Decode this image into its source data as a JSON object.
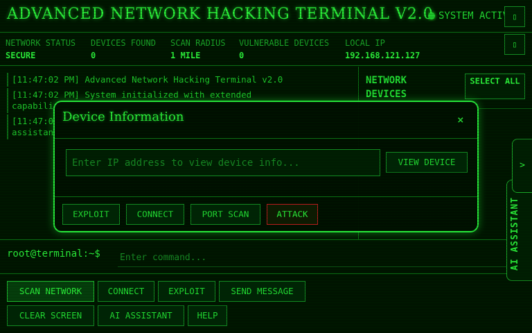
{
  "header": {
    "title": "ADVANCED NETWORK HACKING TERMINAL V2.0",
    "system_status": "SYSTEM ACTIVE",
    "button_glyph": "▯"
  },
  "status": [
    {
      "label": "NETWORK STATUS",
      "value": "SECURE"
    },
    {
      "label": "DEVICES FOUND",
      "value": "0"
    },
    {
      "label": "SCAN RADIUS",
      "value": "1 MILE"
    },
    {
      "label": "VULNERABLE DEVICES",
      "value": "0"
    },
    {
      "label": "LOCAL IP",
      "value": "192.168.121.127"
    }
  ],
  "log": [
    "[11:47:02 PM] Advanced Network Hacking Terminal v2.0",
    "[11:47:02 PM] System initialized with extended",
    "capabili",
    "[11:47:0",
    "assistan"
  ],
  "network_panel": {
    "title": "NETWORK DEVICES",
    "select_all": "SELECT ALL"
  },
  "command": {
    "prompt": "root@terminal:~$",
    "placeholder": "Enter command..."
  },
  "buttons": {
    "scan_network": "SCAN NETWORK",
    "connect": "CONNECT",
    "exploit": "EXPLOIT",
    "send_message": "SEND MESSAGE",
    "clear_screen": "CLEAR SCREEN",
    "ai_assistant": "AI ASSISTANT",
    "help": "HELP"
  },
  "ai_tab": {
    "label": "AI ASSISTANT",
    "toggle": ">"
  },
  "modal": {
    "title": "Device Information",
    "close": "×",
    "ip_placeholder": "Enter IP address to view device info...",
    "view_device": "VIEW DEVICE",
    "actions": {
      "exploit": "EXPLOIT",
      "connect": "CONNECT",
      "port_scan": "PORT SCAN",
      "attack": "ATTACK"
    }
  },
  "colors": {
    "background": "#001400",
    "accent": "#2bf03a",
    "danger": "#b81c1c"
  }
}
